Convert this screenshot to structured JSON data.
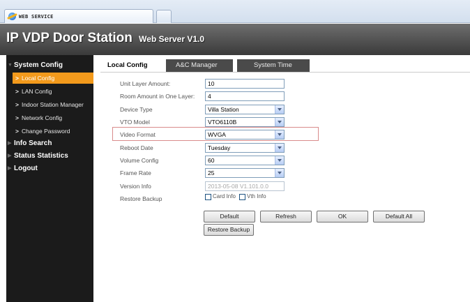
{
  "browser": {
    "tab_title": "WEB SERVICE"
  },
  "header": {
    "title": "IP VDP Door Station",
    "subtitle": "Web Server V1.0"
  },
  "sidebar": {
    "system_config": "System Config",
    "items": [
      {
        "label": "Local Config",
        "active": true
      },
      {
        "label": "LAN Config"
      },
      {
        "label": "Indoor Station Manager"
      },
      {
        "label": "Network Config"
      },
      {
        "label": "Change Password"
      }
    ],
    "info_search": "Info Search",
    "status_statistics": "Status Statistics",
    "logout": "Logout",
    "accent": "#f39a1c"
  },
  "tabs": [
    "Local Config",
    "A&C Manager",
    "System Time"
  ],
  "form": {
    "unit_layer_amount": {
      "label": "Unit Layer Amount:",
      "value": "10"
    },
    "room_amount": {
      "label": "Room Amount in One Layer:",
      "value": "4"
    },
    "device_type": {
      "label": "Device Type",
      "value": "Villa Station"
    },
    "vto_model": {
      "label": "VTO Model",
      "value": "VTO6110B"
    },
    "video_format": {
      "label": "Video Format",
      "value": "WVGA"
    },
    "reboot_date": {
      "label": "Reboot Date",
      "value": "Tuesday"
    },
    "volume_config": {
      "label": "Volume Config",
      "value": "60"
    },
    "frame_rate": {
      "label": "Frame Rate",
      "value": "25"
    },
    "version_info": {
      "label": "Version Info",
      "value": "2013-05-08 V1.101.0.0"
    },
    "restore_backup": {
      "label": "Restore Backup",
      "card_info": "Card Info",
      "vth_info": "Vth Info"
    }
  },
  "buttons": {
    "default": "Default",
    "refresh": "Refresh",
    "ok": "OK",
    "default_all": "Default All",
    "restore_backup": "Restore Backup"
  }
}
